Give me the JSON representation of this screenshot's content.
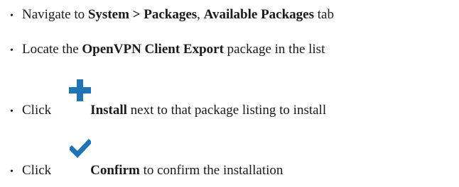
{
  "colors": {
    "text": "#1a1a1a",
    "install_icon": "#1f74b6",
    "confirm_icon": "#1f74b6"
  },
  "steps": [
    {
      "bullet": "•",
      "parts": [
        "Navigate to ",
        "System > Packages",
        ", ",
        "Available Packages",
        " tab"
      ]
    },
    {
      "bullet": "•",
      "parts": [
        "Locate the ",
        "OpenVPN Client Export",
        " package in the list"
      ]
    },
    {
      "bullet": "•",
      "icon": "plus-icon",
      "parts": [
        "Click",
        "Install",
        " next to that package listing to install"
      ]
    },
    {
      "bullet": "•",
      "icon": "check-icon",
      "parts": [
        "Click",
        "Confirm",
        " to confirm the installation"
      ]
    }
  ]
}
